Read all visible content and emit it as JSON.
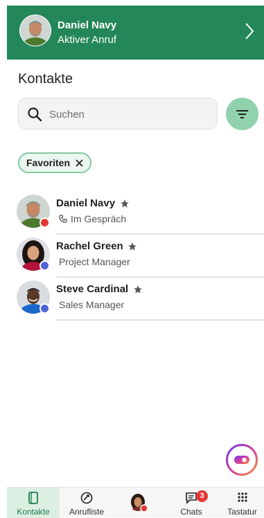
{
  "active_call": {
    "name": "Daniel Navy",
    "status": "Aktiver Anruf"
  },
  "page": {
    "title": "Kontakte"
  },
  "search": {
    "placeholder": "Suchen",
    "value": ""
  },
  "filter_chip": {
    "label": "Favoriten"
  },
  "contacts": [
    {
      "name": "Daniel Navy",
      "subtitle": "Im Gespräch",
      "favorite": true,
      "presence_color": "#e53935",
      "subtitle_icon": "phone-icon"
    },
    {
      "name": "Rachel Green",
      "subtitle": "Project Manager",
      "favorite": true,
      "presence_color": "#4f63d9"
    },
    {
      "name": "Steve Cardinal",
      "subtitle": "Sales Manager",
      "favorite": true,
      "presence_color": "#4f63d9"
    }
  ],
  "bottom_nav": {
    "items": [
      {
        "label": "Kontakte",
        "icon": "contacts-icon",
        "active": true
      },
      {
        "label": "Anrufliste",
        "icon": "call-history-icon",
        "active": false
      },
      {
        "label": "",
        "icon": "profile-avatar",
        "active": false
      },
      {
        "label": "Chats",
        "icon": "chats-icon",
        "badge": "3",
        "active": false
      },
      {
        "label": "Tastatur",
        "icon": "dialpad-icon",
        "active": false
      }
    ]
  },
  "colors": {
    "brand_green": "#24875a",
    "filter_green": "#8fd2ad",
    "presence_busy": "#e53935",
    "presence_away": "#4f63d9",
    "badge_red": "#e53935"
  }
}
